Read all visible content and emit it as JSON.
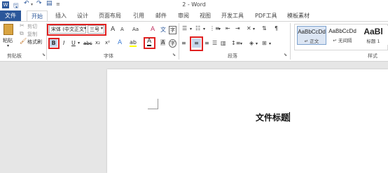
{
  "window": {
    "title": "2 - Word"
  },
  "tabs": [
    "文件",
    "开始",
    "插入",
    "设计",
    "页面布局",
    "引用",
    "邮件",
    "审阅",
    "视图",
    "开发工具",
    "PDF工具",
    "模板素材"
  ],
  "clipboard": {
    "paste": "粘贴",
    "cut": "剪切",
    "copy": "复制",
    "format_painter": "格式刷",
    "group": "剪贴板"
  },
  "font": {
    "name": "宋体 (中文正文",
    "size": "三号",
    "group": "字体",
    "grow": "A",
    "shrink": "A",
    "case": "Aa",
    "bold": "B",
    "italic": "I",
    "underline": "U",
    "strike": "abc",
    "sub": "x₂",
    "sup": "x²",
    "text_effect": "A",
    "highlight": "ab",
    "font_color": "A",
    "char_shading": "A",
    "encircle": "字",
    "phonetic": "文",
    "clear_format": "A"
  },
  "paragraph": {
    "group": "段落"
  },
  "styles": {
    "group": "样式",
    "items": [
      {
        "preview": "AaBbCcDd",
        "name": "↵ 正文"
      },
      {
        "preview": "AaBbCcDd",
        "name": "↵ 无间隔"
      },
      {
        "preview": "AaBl",
        "name": "标题 1"
      }
    ]
  },
  "document": {
    "text": "文件标题"
  },
  "colors": {
    "accent": "#2b579a",
    "highlight_box": "#e02020"
  }
}
